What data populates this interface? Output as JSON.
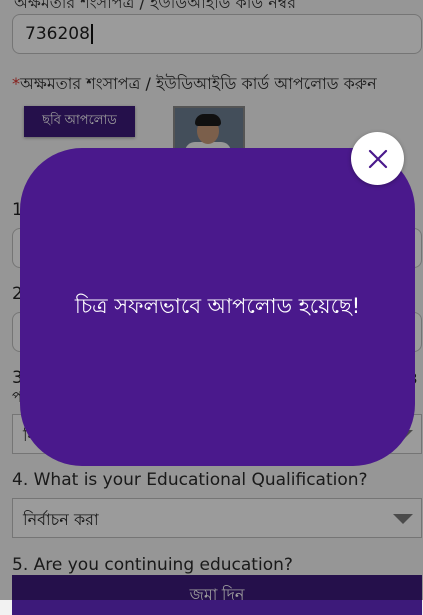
{
  "form": {
    "top_cut_label": "অক্ষমতার শংসাপত্র / ইউডিআইডি কার্ড নম্বর",
    "certificate_number_value": "736208",
    "upload_label_required_mark": "*",
    "upload_label": "অক্ষমতার শংসাপত্র / ইউডিআইডি কার্ড আপলোড করুন",
    "upload_button_label": "ছবি আপলোড",
    "q1_number": "1.",
    "q2_number": "2.",
    "q3_number": "3",
    "q3_wrap_char": "প",
    "q3_right_char": "3",
    "q3_select_value_partial": "নির্বা",
    "q4_label": "4. What is your Educational Qualification?",
    "q4_select_value": "নির্বাচন করা",
    "q5_label": "5. Are you continuing education?",
    "submit_label": "জমা দিন"
  },
  "modal": {
    "message": "চিত্র সফলভাবে আপলোড হয়েছে!",
    "close_icon": "close-icon"
  },
  "colors": {
    "brand_purple": "#4a198c",
    "button_purple": "#3d1a7a",
    "required_red": "#d9322d"
  }
}
